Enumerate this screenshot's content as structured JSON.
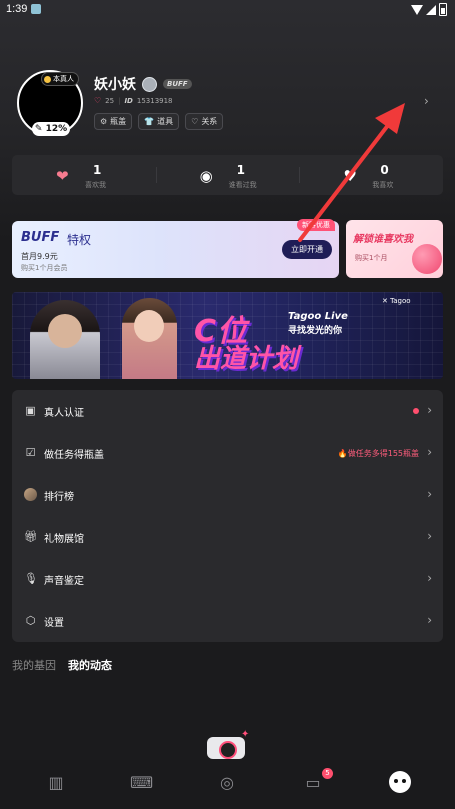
{
  "status_bar": {
    "time": "1:39"
  },
  "profile": {
    "real_badge": "本真人",
    "level": "12%",
    "nickname": "妖小妖",
    "buff_tag": "BUFF",
    "likes": "25",
    "id_label": "ID",
    "id_value": "15313918",
    "pills": [
      {
        "label": "瓶盖",
        "icon": "gear-icon"
      },
      {
        "label": "道具",
        "icon": "shirt-icon"
      },
      {
        "label": "关系",
        "icon": "heart-outline-icon"
      }
    ]
  },
  "stats": [
    {
      "value": "1",
      "label": "喜欢我",
      "icon": "heart-icon",
      "color": "#f67b8f"
    },
    {
      "value": "1",
      "label": "谁看过我",
      "icon": "eye-icon",
      "color": "#ffffff"
    },
    {
      "value": "0",
      "label": "我喜欢",
      "icon": "heart-pulse-icon",
      "color": "#ffffff"
    }
  ],
  "buff_card": {
    "logo": "BUFF",
    "title": "特权",
    "price": "首月9.9元",
    "sub": "购买1个月会员",
    "button": "立即开通",
    "badge": "新客优惠"
  },
  "love_card": {
    "title": "解锁谁喜欢我",
    "sub": "购买1个月"
  },
  "banner": {
    "line1": "C位",
    "line2": "出道计划",
    "tagline1": "Tagoo Live",
    "tagline2": "寻找发光的你",
    "brand": "✕ Tagoo"
  },
  "menu": [
    {
      "label": "真人认证",
      "icon": "id-card-icon",
      "has_dot": true,
      "tip": ""
    },
    {
      "label": "做任务得瓶盖",
      "icon": "calendar-check-icon",
      "has_dot": false,
      "tip": "🔥做任务多得155瓶盖"
    },
    {
      "label": "排行榜",
      "icon": "avatar-icon",
      "has_dot": false,
      "tip": ""
    },
    {
      "label": "礼物展馆",
      "icon": "gift-icon",
      "has_dot": false,
      "tip": ""
    },
    {
      "label": "声音鉴定",
      "icon": "microphone-icon",
      "has_dot": false,
      "tip": ""
    },
    {
      "label": "设置",
      "icon": "settings-icon",
      "has_dot": false,
      "tip": ""
    }
  ],
  "tabs": [
    "我的基因",
    "我的动态"
  ],
  "nav": {
    "items": [
      "cards-icon",
      "gamepad-icon",
      "planet-icon",
      "message-icon",
      "me-icon"
    ],
    "message_badge": "5"
  },
  "colors": {
    "accent_pink": "#ff4f6e",
    "bg": "#1b1b1d",
    "card": "#2a2a2d",
    "annotation_arrow": "#f03a3a"
  }
}
